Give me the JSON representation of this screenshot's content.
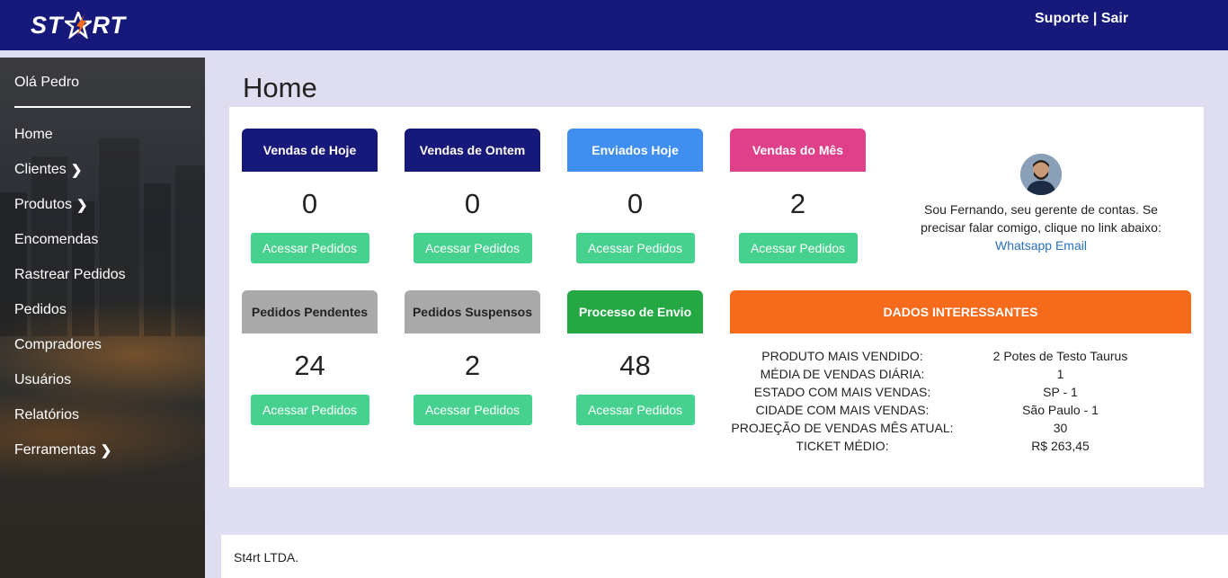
{
  "header": {
    "logo_left": "ST",
    "logo_right": "RT",
    "logo_icon": "star-rocket-icon",
    "support_label": "Suporte",
    "separator": "|",
    "logout_label": "Sair"
  },
  "sidebar": {
    "greeting": "Olá Pedro",
    "items": [
      {
        "label": "Home",
        "has_submenu": false
      },
      {
        "label": "Clientes",
        "has_submenu": true
      },
      {
        "label": "Produtos",
        "has_submenu": true
      },
      {
        "label": "Encomendas",
        "has_submenu": false
      },
      {
        "label": "Rastrear Pedidos",
        "has_submenu": false
      },
      {
        "label": "Pedidos",
        "has_submenu": false
      },
      {
        "label": "Compradores",
        "has_submenu": false
      },
      {
        "label": "Usuários",
        "has_submenu": false
      },
      {
        "label": "Relatórios",
        "has_submenu": false
      },
      {
        "label": "Ferramentas",
        "has_submenu": true
      }
    ]
  },
  "page": {
    "title": "Home"
  },
  "cards": [
    {
      "title": "Vendas de Hoje",
      "value": "0",
      "button": "Acessar Pedidos",
      "color": "#16187a"
    },
    {
      "title": "Vendas de Ontem",
      "value": "0",
      "button": "Acessar Pedidos",
      "color": "#16187a"
    },
    {
      "title": "Enviados Hoje",
      "value": "0",
      "button": "Acessar Pedidos",
      "color": "#3f8ef0"
    },
    {
      "title": "Vendas do Mês",
      "value": "2",
      "button": "Acessar Pedidos",
      "color": "#e0408a"
    },
    {
      "title": "Pedidos Pendentes",
      "value": "24",
      "button": "Acessar Pedidos",
      "color": "#a9a9a9"
    },
    {
      "title": "Pedidos Suspensos",
      "value": "2",
      "button": "Acessar Pedidos",
      "color": "#a9a9a9"
    },
    {
      "title": "Processo de Envio",
      "value": "48",
      "button": "Acessar Pedidos",
      "color": "#25a744"
    }
  ],
  "manager": {
    "text_line1": "Sou Fernando, seu gerente de contas. Se",
    "text_line2": "precisar falar comigo, clique no link abaixo:",
    "whatsapp_label": "Whatsapp",
    "email_label": "Email"
  },
  "dados": {
    "title": "DADOS INTERESSANTES",
    "rows": [
      {
        "label": "PRODUTO MAIS VENDIDO:",
        "value": "2 Potes de Testo Taurus"
      },
      {
        "label": "MÉDIA DE VENDAS DIÁRIA:",
        "value": "1"
      },
      {
        "label": "ESTADO COM MAIS VENDAS:",
        "value": "SP - 1"
      },
      {
        "label": "CIDADE COM MAIS VENDAS:",
        "value": "São Paulo - 1"
      },
      {
        "label": "PROJEÇÃO DE VENDAS MÊS ATUAL:",
        "value": "30"
      },
      {
        "label": "TICKET MÉDIO:",
        "value": "R$ 263,45"
      }
    ]
  },
  "footer": {
    "text": "St4rt LTDA."
  }
}
